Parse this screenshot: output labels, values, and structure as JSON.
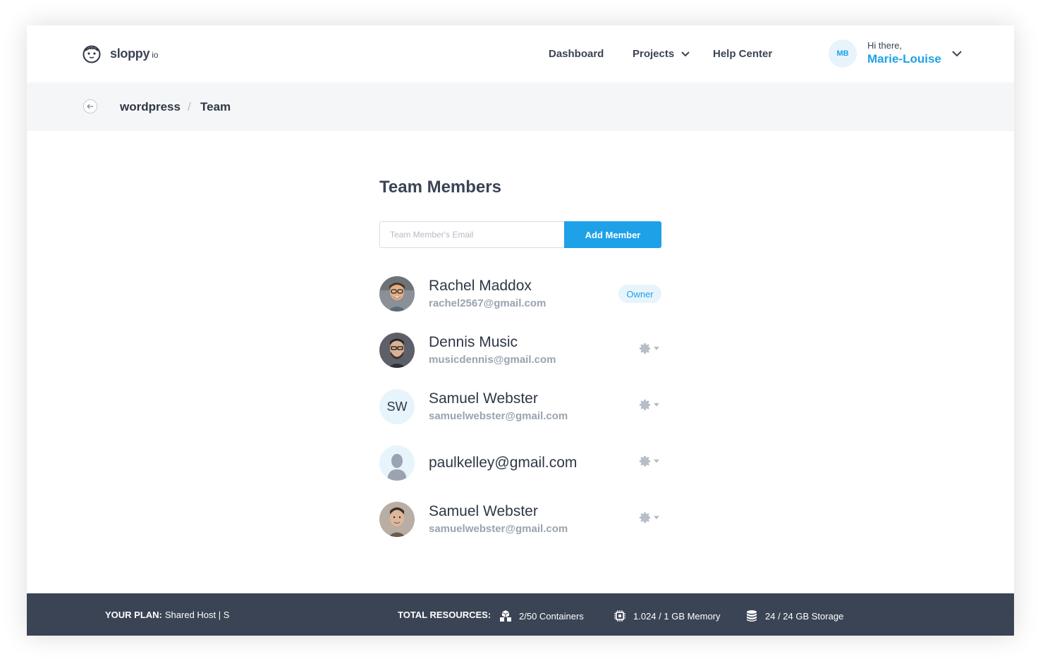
{
  "header": {
    "brand": "sloppy",
    "brand_suffix": "io",
    "nav": {
      "dashboard": "Dashboard",
      "projects": "Projects",
      "help": "Help Center"
    },
    "user": {
      "initials": "MB",
      "greeting": "Hi there,",
      "name": "Marie-Louise"
    }
  },
  "breadcrumb": {
    "project": "wordpress",
    "separator": "/",
    "current": "Team"
  },
  "main": {
    "title": "Team Members",
    "email_placeholder": "Team Member's Email",
    "add_button": "Add Member",
    "members": [
      {
        "name": "Rachel Maddox",
        "email": "rachel2567@gmail.com",
        "badge": "Owner"
      },
      {
        "name": "Dennis Music",
        "email": "musicdennis@gmail.com"
      },
      {
        "name": "Samuel Webster",
        "email": "samuelwebster@gmail.com",
        "initials": "SW"
      },
      {
        "name": "paulkelley@gmail.com"
      },
      {
        "name": "Samuel Webster",
        "email": "samuelwebster@gmail.com"
      }
    ]
  },
  "footer": {
    "plan_label": "YOUR PLAN:",
    "plan_value": "Shared Host | S",
    "total_label": "TOTAL RESOURCES:",
    "containers": "2/50 Containers",
    "memory": "1.024 / 1 GB Memory",
    "storage": "24 / 24 GB Storage"
  },
  "colors": {
    "accent": "#1ea1e6",
    "footer_bg": "#3b4455",
    "text_dark": "#2f3746",
    "text_muted": "#9aa3af"
  },
  "icons": [
    "sloth-logo-icon",
    "chevron-down-icon",
    "back-arrow-icon",
    "gear-icon",
    "caret-down-icon",
    "containers-icon",
    "chip-icon",
    "database-icon",
    "user-silhouette-icon"
  ]
}
